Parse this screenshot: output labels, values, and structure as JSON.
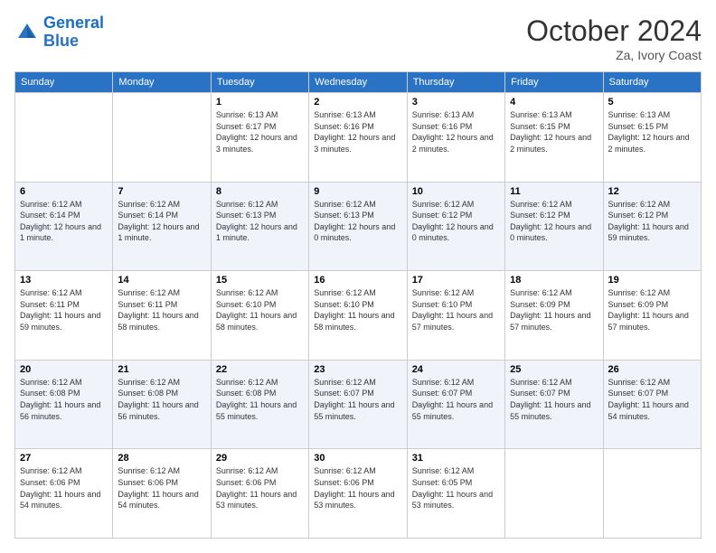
{
  "logo": {
    "line1": "General",
    "line2": "Blue"
  },
  "title": "October 2024",
  "subtitle": "Za, Ivory Coast",
  "days_of_week": [
    "Sunday",
    "Monday",
    "Tuesday",
    "Wednesday",
    "Thursday",
    "Friday",
    "Saturday"
  ],
  "weeks": [
    [
      {
        "day": "",
        "info": ""
      },
      {
        "day": "",
        "info": ""
      },
      {
        "day": "1",
        "info": "Sunrise: 6:13 AM\nSunset: 6:17 PM\nDaylight: 12 hours and 3 minutes."
      },
      {
        "day": "2",
        "info": "Sunrise: 6:13 AM\nSunset: 6:16 PM\nDaylight: 12 hours and 3 minutes."
      },
      {
        "day": "3",
        "info": "Sunrise: 6:13 AM\nSunset: 6:16 PM\nDaylight: 12 hours and 2 minutes."
      },
      {
        "day": "4",
        "info": "Sunrise: 6:13 AM\nSunset: 6:15 PM\nDaylight: 12 hours and 2 minutes."
      },
      {
        "day": "5",
        "info": "Sunrise: 6:13 AM\nSunset: 6:15 PM\nDaylight: 12 hours and 2 minutes."
      }
    ],
    [
      {
        "day": "6",
        "info": "Sunrise: 6:12 AM\nSunset: 6:14 PM\nDaylight: 12 hours and 1 minute."
      },
      {
        "day": "7",
        "info": "Sunrise: 6:12 AM\nSunset: 6:14 PM\nDaylight: 12 hours and 1 minute."
      },
      {
        "day": "8",
        "info": "Sunrise: 6:12 AM\nSunset: 6:13 PM\nDaylight: 12 hours and 1 minute."
      },
      {
        "day": "9",
        "info": "Sunrise: 6:12 AM\nSunset: 6:13 PM\nDaylight: 12 hours and 0 minutes."
      },
      {
        "day": "10",
        "info": "Sunrise: 6:12 AM\nSunset: 6:12 PM\nDaylight: 12 hours and 0 minutes."
      },
      {
        "day": "11",
        "info": "Sunrise: 6:12 AM\nSunset: 6:12 PM\nDaylight: 12 hours and 0 minutes."
      },
      {
        "day": "12",
        "info": "Sunrise: 6:12 AM\nSunset: 6:12 PM\nDaylight: 11 hours and 59 minutes."
      }
    ],
    [
      {
        "day": "13",
        "info": "Sunrise: 6:12 AM\nSunset: 6:11 PM\nDaylight: 11 hours and 59 minutes."
      },
      {
        "day": "14",
        "info": "Sunrise: 6:12 AM\nSunset: 6:11 PM\nDaylight: 11 hours and 58 minutes."
      },
      {
        "day": "15",
        "info": "Sunrise: 6:12 AM\nSunset: 6:10 PM\nDaylight: 11 hours and 58 minutes."
      },
      {
        "day": "16",
        "info": "Sunrise: 6:12 AM\nSunset: 6:10 PM\nDaylight: 11 hours and 58 minutes."
      },
      {
        "day": "17",
        "info": "Sunrise: 6:12 AM\nSunset: 6:10 PM\nDaylight: 11 hours and 57 minutes."
      },
      {
        "day": "18",
        "info": "Sunrise: 6:12 AM\nSunset: 6:09 PM\nDaylight: 11 hours and 57 minutes."
      },
      {
        "day": "19",
        "info": "Sunrise: 6:12 AM\nSunset: 6:09 PM\nDaylight: 11 hours and 57 minutes."
      }
    ],
    [
      {
        "day": "20",
        "info": "Sunrise: 6:12 AM\nSunset: 6:08 PM\nDaylight: 11 hours and 56 minutes."
      },
      {
        "day": "21",
        "info": "Sunrise: 6:12 AM\nSunset: 6:08 PM\nDaylight: 11 hours and 56 minutes."
      },
      {
        "day": "22",
        "info": "Sunrise: 6:12 AM\nSunset: 6:08 PM\nDaylight: 11 hours and 55 minutes."
      },
      {
        "day": "23",
        "info": "Sunrise: 6:12 AM\nSunset: 6:07 PM\nDaylight: 11 hours and 55 minutes."
      },
      {
        "day": "24",
        "info": "Sunrise: 6:12 AM\nSunset: 6:07 PM\nDaylight: 11 hours and 55 minutes."
      },
      {
        "day": "25",
        "info": "Sunrise: 6:12 AM\nSunset: 6:07 PM\nDaylight: 11 hours and 55 minutes."
      },
      {
        "day": "26",
        "info": "Sunrise: 6:12 AM\nSunset: 6:07 PM\nDaylight: 11 hours and 54 minutes."
      }
    ],
    [
      {
        "day": "27",
        "info": "Sunrise: 6:12 AM\nSunset: 6:06 PM\nDaylight: 11 hours and 54 minutes."
      },
      {
        "day": "28",
        "info": "Sunrise: 6:12 AM\nSunset: 6:06 PM\nDaylight: 11 hours and 54 minutes."
      },
      {
        "day": "29",
        "info": "Sunrise: 6:12 AM\nSunset: 6:06 PM\nDaylight: 11 hours and 53 minutes."
      },
      {
        "day": "30",
        "info": "Sunrise: 6:12 AM\nSunset: 6:06 PM\nDaylight: 11 hours and 53 minutes."
      },
      {
        "day": "31",
        "info": "Sunrise: 6:12 AM\nSunset: 6:05 PM\nDaylight: 11 hours and 53 minutes."
      },
      {
        "day": "",
        "info": ""
      },
      {
        "day": "",
        "info": ""
      }
    ]
  ]
}
